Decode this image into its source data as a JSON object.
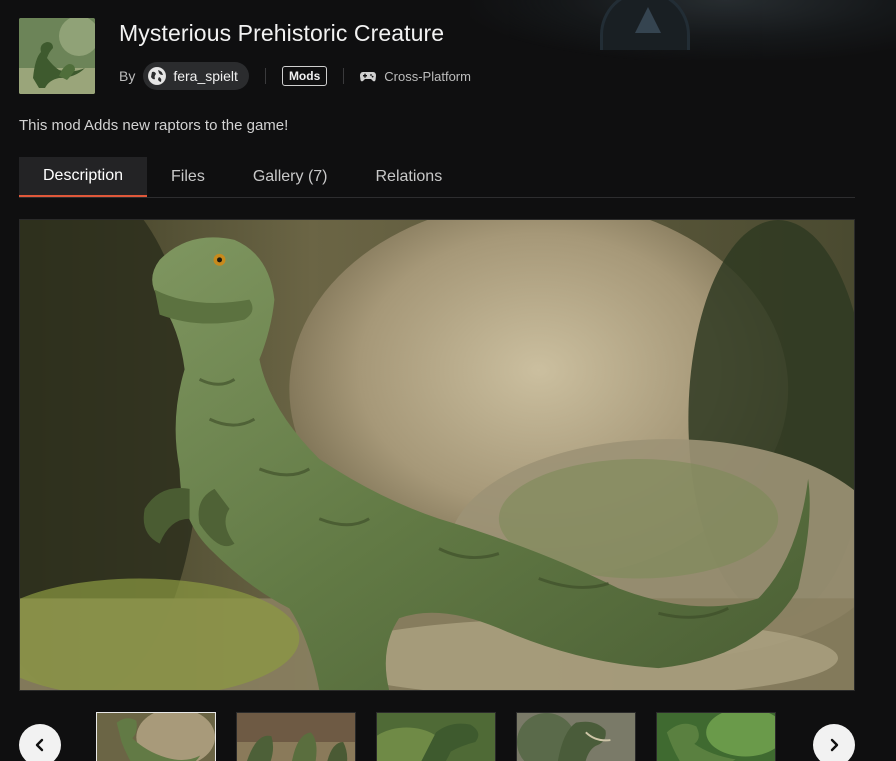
{
  "mod": {
    "title": "Mysterious Prehistoric Creature",
    "by_label": "By",
    "author": "fera_spielt",
    "tag": "Mods",
    "platform": "Cross-Platform",
    "summary": "This mod Adds new raptors to the game!"
  },
  "tabs": [
    {
      "label": "Description",
      "active": true
    },
    {
      "label": "Files",
      "active": false
    },
    {
      "label": "Gallery (7)",
      "active": false
    },
    {
      "label": "Relations",
      "active": false
    }
  ],
  "gallery": {
    "selected_index": 0,
    "thumbnails": [
      {
        "name": "gallery-thumb-1"
      },
      {
        "name": "gallery-thumb-2"
      },
      {
        "name": "gallery-thumb-3"
      },
      {
        "name": "gallery-thumb-4"
      },
      {
        "name": "gallery-thumb-5"
      }
    ],
    "prev_icon": "chevron-left-icon",
    "next_icon": "chevron-right-icon"
  },
  "colors": {
    "background": "#0f0f10",
    "active_tab_accent": "#e0583a",
    "pill_background": "#2b2c2e"
  }
}
